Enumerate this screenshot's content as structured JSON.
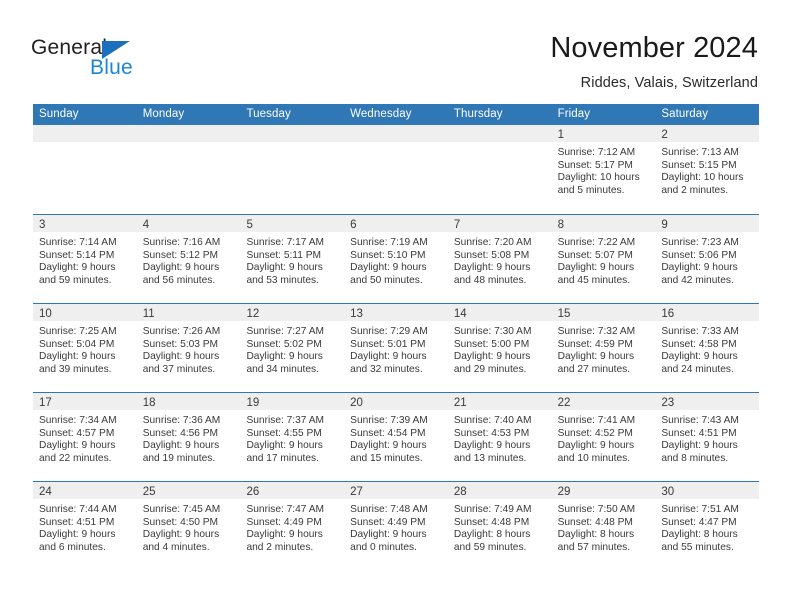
{
  "brand": {
    "word_general": "General",
    "word_blue": "Blue",
    "accent_blue": "#1c6fba",
    "light_blue": "#1c86d6"
  },
  "header": {
    "month_title": "November 2024",
    "location": "Riddes, Valais, Switzerland",
    "header_bg": "#3077b6",
    "band_bg": "#efefef"
  },
  "day_headers": [
    "Sunday",
    "Monday",
    "Tuesday",
    "Wednesday",
    "Thursday",
    "Friday",
    "Saturday"
  ],
  "weeks": [
    [
      {
        "day": "",
        "sunrise": "",
        "sunset": "",
        "daylight_1": "",
        "daylight_2": ""
      },
      {
        "day": "",
        "sunrise": "",
        "sunset": "",
        "daylight_1": "",
        "daylight_2": ""
      },
      {
        "day": "",
        "sunrise": "",
        "sunset": "",
        "daylight_1": "",
        "daylight_2": ""
      },
      {
        "day": "",
        "sunrise": "",
        "sunset": "",
        "daylight_1": "",
        "daylight_2": ""
      },
      {
        "day": "",
        "sunrise": "",
        "sunset": "",
        "daylight_1": "",
        "daylight_2": ""
      },
      {
        "day": "1",
        "sunrise": "Sunrise: 7:12 AM",
        "sunset": "Sunset: 5:17 PM",
        "daylight_1": "Daylight: 10 hours",
        "daylight_2": "and 5 minutes."
      },
      {
        "day": "2",
        "sunrise": "Sunrise: 7:13 AM",
        "sunset": "Sunset: 5:15 PM",
        "daylight_1": "Daylight: 10 hours",
        "daylight_2": "and 2 minutes."
      }
    ],
    [
      {
        "day": "3",
        "sunrise": "Sunrise: 7:14 AM",
        "sunset": "Sunset: 5:14 PM",
        "daylight_1": "Daylight: 9 hours",
        "daylight_2": "and 59 minutes."
      },
      {
        "day": "4",
        "sunrise": "Sunrise: 7:16 AM",
        "sunset": "Sunset: 5:12 PM",
        "daylight_1": "Daylight: 9 hours",
        "daylight_2": "and 56 minutes."
      },
      {
        "day": "5",
        "sunrise": "Sunrise: 7:17 AM",
        "sunset": "Sunset: 5:11 PM",
        "daylight_1": "Daylight: 9 hours",
        "daylight_2": "and 53 minutes."
      },
      {
        "day": "6",
        "sunrise": "Sunrise: 7:19 AM",
        "sunset": "Sunset: 5:10 PM",
        "daylight_1": "Daylight: 9 hours",
        "daylight_2": "and 50 minutes."
      },
      {
        "day": "7",
        "sunrise": "Sunrise: 7:20 AM",
        "sunset": "Sunset: 5:08 PM",
        "daylight_1": "Daylight: 9 hours",
        "daylight_2": "and 48 minutes."
      },
      {
        "day": "8",
        "sunrise": "Sunrise: 7:22 AM",
        "sunset": "Sunset: 5:07 PM",
        "daylight_1": "Daylight: 9 hours",
        "daylight_2": "and 45 minutes."
      },
      {
        "day": "9",
        "sunrise": "Sunrise: 7:23 AM",
        "sunset": "Sunset: 5:06 PM",
        "daylight_1": "Daylight: 9 hours",
        "daylight_2": "and 42 minutes."
      }
    ],
    [
      {
        "day": "10",
        "sunrise": "Sunrise: 7:25 AM",
        "sunset": "Sunset: 5:04 PM",
        "daylight_1": "Daylight: 9 hours",
        "daylight_2": "and 39 minutes."
      },
      {
        "day": "11",
        "sunrise": "Sunrise: 7:26 AM",
        "sunset": "Sunset: 5:03 PM",
        "daylight_1": "Daylight: 9 hours",
        "daylight_2": "and 37 minutes."
      },
      {
        "day": "12",
        "sunrise": "Sunrise: 7:27 AM",
        "sunset": "Sunset: 5:02 PM",
        "daylight_1": "Daylight: 9 hours",
        "daylight_2": "and 34 minutes."
      },
      {
        "day": "13",
        "sunrise": "Sunrise: 7:29 AM",
        "sunset": "Sunset: 5:01 PM",
        "daylight_1": "Daylight: 9 hours",
        "daylight_2": "and 32 minutes."
      },
      {
        "day": "14",
        "sunrise": "Sunrise: 7:30 AM",
        "sunset": "Sunset: 5:00 PM",
        "daylight_1": "Daylight: 9 hours",
        "daylight_2": "and 29 minutes."
      },
      {
        "day": "15",
        "sunrise": "Sunrise: 7:32 AM",
        "sunset": "Sunset: 4:59 PM",
        "daylight_1": "Daylight: 9 hours",
        "daylight_2": "and 27 minutes."
      },
      {
        "day": "16",
        "sunrise": "Sunrise: 7:33 AM",
        "sunset": "Sunset: 4:58 PM",
        "daylight_1": "Daylight: 9 hours",
        "daylight_2": "and 24 minutes."
      }
    ],
    [
      {
        "day": "17",
        "sunrise": "Sunrise: 7:34 AM",
        "sunset": "Sunset: 4:57 PM",
        "daylight_1": "Daylight: 9 hours",
        "daylight_2": "and 22 minutes."
      },
      {
        "day": "18",
        "sunrise": "Sunrise: 7:36 AM",
        "sunset": "Sunset: 4:56 PM",
        "daylight_1": "Daylight: 9 hours",
        "daylight_2": "and 19 minutes."
      },
      {
        "day": "19",
        "sunrise": "Sunrise: 7:37 AM",
        "sunset": "Sunset: 4:55 PM",
        "daylight_1": "Daylight: 9 hours",
        "daylight_2": "and 17 minutes."
      },
      {
        "day": "20",
        "sunrise": "Sunrise: 7:39 AM",
        "sunset": "Sunset: 4:54 PM",
        "daylight_1": "Daylight: 9 hours",
        "daylight_2": "and 15 minutes."
      },
      {
        "day": "21",
        "sunrise": "Sunrise: 7:40 AM",
        "sunset": "Sunset: 4:53 PM",
        "daylight_1": "Daylight: 9 hours",
        "daylight_2": "and 13 minutes."
      },
      {
        "day": "22",
        "sunrise": "Sunrise: 7:41 AM",
        "sunset": "Sunset: 4:52 PM",
        "daylight_1": "Daylight: 9 hours",
        "daylight_2": "and 10 minutes."
      },
      {
        "day": "23",
        "sunrise": "Sunrise: 7:43 AM",
        "sunset": "Sunset: 4:51 PM",
        "daylight_1": "Daylight: 9 hours",
        "daylight_2": "and 8 minutes."
      }
    ],
    [
      {
        "day": "24",
        "sunrise": "Sunrise: 7:44 AM",
        "sunset": "Sunset: 4:51 PM",
        "daylight_1": "Daylight: 9 hours",
        "daylight_2": "and 6 minutes."
      },
      {
        "day": "25",
        "sunrise": "Sunrise: 7:45 AM",
        "sunset": "Sunset: 4:50 PM",
        "daylight_1": "Daylight: 9 hours",
        "daylight_2": "and 4 minutes."
      },
      {
        "day": "26",
        "sunrise": "Sunrise: 7:47 AM",
        "sunset": "Sunset: 4:49 PM",
        "daylight_1": "Daylight: 9 hours",
        "daylight_2": "and 2 minutes."
      },
      {
        "day": "27",
        "sunrise": "Sunrise: 7:48 AM",
        "sunset": "Sunset: 4:49 PM",
        "daylight_1": "Daylight: 9 hours",
        "daylight_2": "and 0 minutes."
      },
      {
        "day": "28",
        "sunrise": "Sunrise: 7:49 AM",
        "sunset": "Sunset: 4:48 PM",
        "daylight_1": "Daylight: 8 hours",
        "daylight_2": "and 59 minutes."
      },
      {
        "day": "29",
        "sunrise": "Sunrise: 7:50 AM",
        "sunset": "Sunset: 4:48 PM",
        "daylight_1": "Daylight: 8 hours",
        "daylight_2": "and 57 minutes."
      },
      {
        "day": "30",
        "sunrise": "Sunrise: 7:51 AM",
        "sunset": "Sunset: 4:47 PM",
        "daylight_1": "Daylight: 8 hours",
        "daylight_2": "and 55 minutes."
      }
    ]
  ]
}
